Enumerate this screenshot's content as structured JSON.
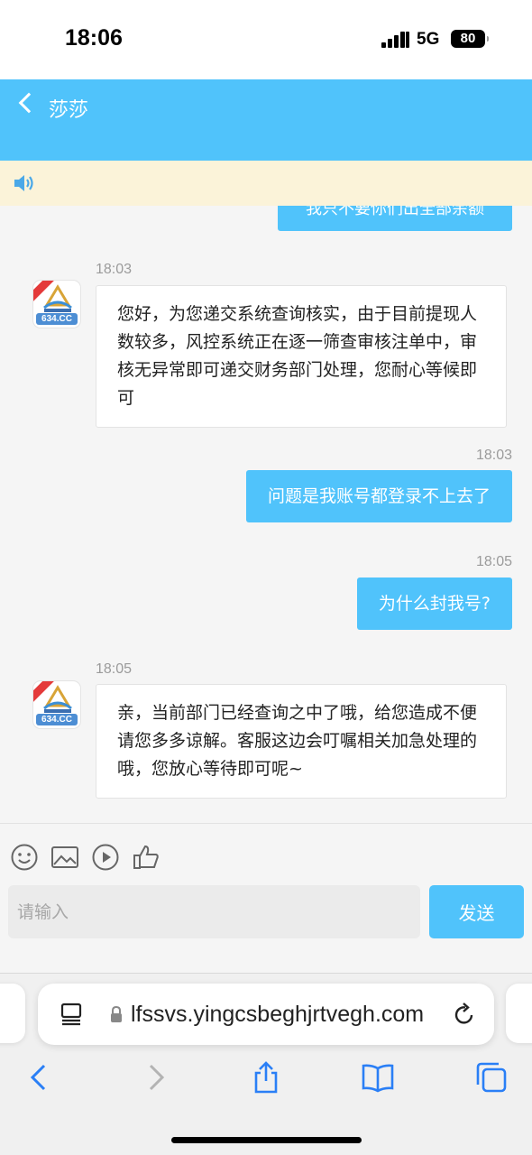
{
  "status_bar": {
    "time": "18:06",
    "network": "5G",
    "battery": "80"
  },
  "header": {
    "back_label": "<",
    "title": "莎莎"
  },
  "notice": {
    "icon": "speaker-icon"
  },
  "messages": {
    "clipped_previous": "我只不要你们出全部余额",
    "list": [
      {
        "side": "left",
        "time": "18:03",
        "text": "您好，为您递交系统查询核实，由于目前提现人数较多，风控系统正在逐一筛查审核注单中，审核无异常即可递交财务部门处理，您耐心等候即可"
      },
      {
        "side": "right",
        "time": "18:03",
        "text": "问题是我账号都登录不上去了"
      },
      {
        "side": "right",
        "time": "18:05",
        "text": "为什么封我号?"
      },
      {
        "side": "left",
        "time": "18:05",
        "text": "亲，当前部门已经查询之中了哦，给您造成不便请您多多谅解。客服这边会叮嘱相关加急处理的哦，您放心等待即可呢~"
      }
    ],
    "avatar_label": "634.CC"
  },
  "input": {
    "placeholder": "请输入",
    "value": "",
    "send_label": "发送"
  },
  "toolbar_icons": [
    "emoji-icon",
    "image-icon",
    "video-icon",
    "thumbs-up-icon"
  ],
  "browser": {
    "url": "lfssvs.yingcsbeghjrtvegh.com"
  },
  "colors": {
    "accent": "#50c3fb",
    "notice_bg": "#fbf3d9",
    "page_bg": "#f5f5f5"
  }
}
